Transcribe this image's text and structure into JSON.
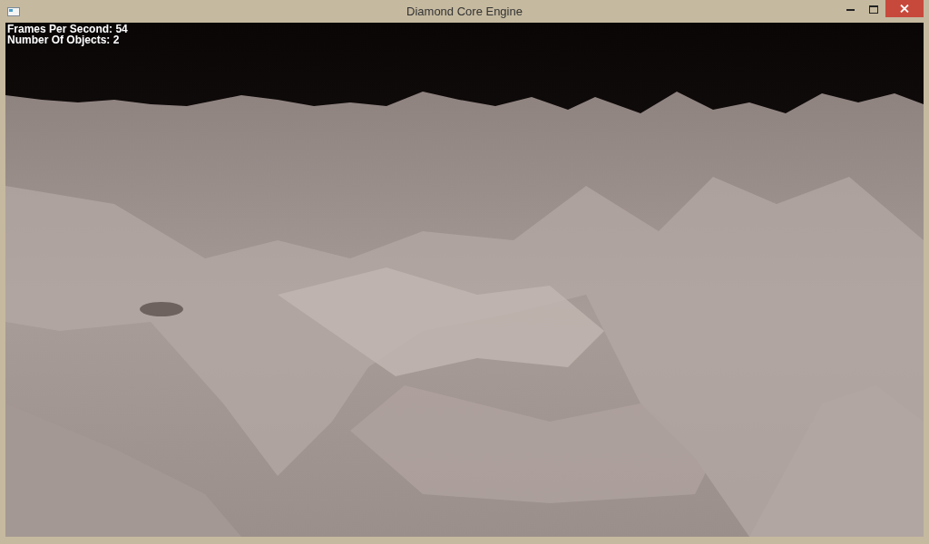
{
  "window": {
    "title": "Diamond Core Engine"
  },
  "hud": [
    "Frames Per Second: 54",
    "Number Of Objects: 2"
  ]
}
